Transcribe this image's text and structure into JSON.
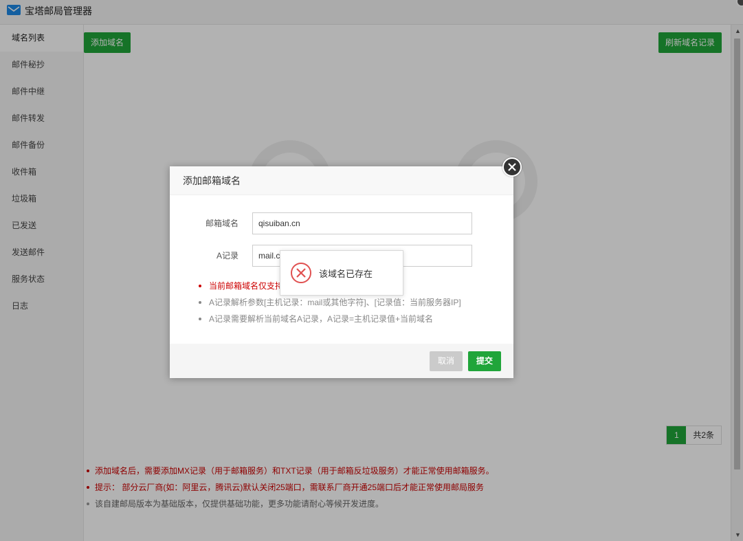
{
  "window": {
    "title": "宝塔邮局管理器"
  },
  "sidebar": {
    "items": [
      {
        "label": "域名列表"
      },
      {
        "label": "邮件秘抄"
      },
      {
        "label": "邮件中继"
      },
      {
        "label": "邮件转发"
      },
      {
        "label": "邮件备份"
      },
      {
        "label": "收件箱"
      },
      {
        "label": "垃圾箱"
      },
      {
        "label": "已发送"
      },
      {
        "label": "发送邮件"
      },
      {
        "label": "服务状态"
      },
      {
        "label": "日志"
      }
    ]
  },
  "toolbar": {
    "add_label": "添加域名",
    "refresh_label": "刷新域名记录"
  },
  "pagination": {
    "current": "1",
    "total_label": "共2条"
  },
  "notes": [
    "添加域名后，需要添加MX记录（用于邮箱服务）和TXT记录（用于邮箱反垃圾服务）才能正常使用邮箱服务。",
    "提示：  部分云厂商(如：阿里云，腾讯云)默认关闭25端口，需联系厂商开通25端口后才能正常使用邮局服务",
    "该自建邮局版本为基础版本，仅提供基础功能，更多功能请耐心等候开发进度。"
  ],
  "dialog": {
    "title": "添加邮箱域名",
    "domain_label": "邮箱域名",
    "domain_value": "qisuiban.cn",
    "arecord_label": "A记录",
    "arecord_value": "mail.c",
    "tips": [
      "当前邮箱域名仅支持",
      "A记录解析参数[主机记录：mail或其他字符]、[记录值：当前服务器IP]",
      "A记录需要解析当前域名A记录，A记录=主机记录值+当前域名"
    ],
    "cancel_label": "取消",
    "submit_label": "提交"
  },
  "toast": {
    "message": "该域名已存在"
  },
  "colors": {
    "accent": "#20a53a",
    "error": "#cc0000"
  }
}
